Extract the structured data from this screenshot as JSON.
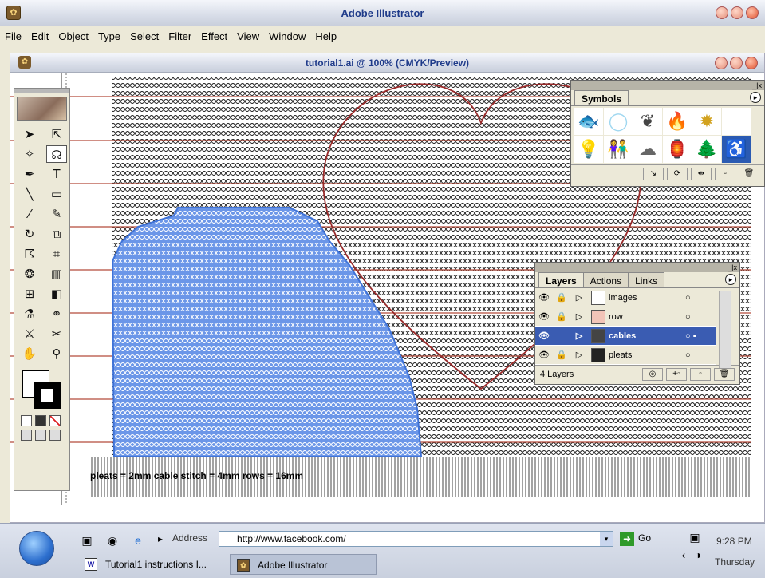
{
  "app": {
    "title": "Adobe Illustrator",
    "menu": [
      "File",
      "Edit",
      "Object",
      "Type",
      "Select",
      "Filter",
      "Effect",
      "View",
      "Window",
      "Help"
    ]
  },
  "document": {
    "title": "tutorial1.ai @ 100% (CMYK/Preview)",
    "annotation": "pleats = 2mm  cable stitch = 4mm  rows = 16mm"
  },
  "symbols_panel": {
    "tab": "Symbols",
    "symbols": [
      "fish-icon",
      "bubble-icon",
      "grapes-icon",
      "fire-icon",
      "gear-sun-icon",
      "blank-symbol",
      "lightbulb-icon",
      "people-icon",
      "cloud-icon",
      "lantern-icon",
      "tree-icon",
      "wheelchair-icon"
    ],
    "colors": {
      "accent": "#3a5cb2",
      "panel_bg": "#ece9d8"
    }
  },
  "layers_panel": {
    "tabs": [
      "Layers",
      "Actions",
      "Links"
    ],
    "layers": [
      {
        "name": "images",
        "swatch": "#ffffff",
        "visible": true,
        "locked": true,
        "selected": false
      },
      {
        "name": "row",
        "swatch": "#f2c4b8",
        "visible": true,
        "locked": true,
        "selected": false
      },
      {
        "name": "cables",
        "swatch": "#444444",
        "visible": true,
        "locked": false,
        "selected": true
      },
      {
        "name": "pleats",
        "swatch": "#222222",
        "visible": true,
        "locked": true,
        "selected": false
      }
    ],
    "count_label": "4 Layers"
  },
  "taskbar": {
    "address_label": "Address",
    "address_value": "http://www.facebook.com/",
    "go_label": "Go",
    "time": "9:28 PM",
    "day": "Thursday",
    "tasks": [
      {
        "label": "Tutorial1 instructions I...",
        "icon": "word-doc-icon",
        "active": false
      },
      {
        "label": "Adobe Illustrator",
        "icon": "illustrator-icon",
        "active": true
      }
    ]
  }
}
